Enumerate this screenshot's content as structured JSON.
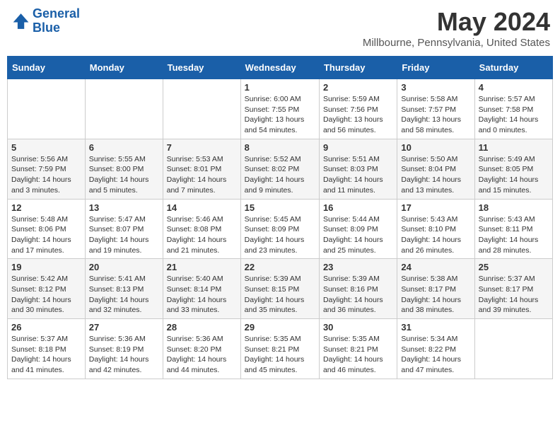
{
  "header": {
    "logo_line1": "General",
    "logo_line2": "Blue",
    "month": "May 2024",
    "location": "Millbourne, Pennsylvania, United States"
  },
  "weekdays": [
    "Sunday",
    "Monday",
    "Tuesday",
    "Wednesday",
    "Thursday",
    "Friday",
    "Saturday"
  ],
  "weeks": [
    [
      {
        "day": "",
        "info": ""
      },
      {
        "day": "",
        "info": ""
      },
      {
        "day": "",
        "info": ""
      },
      {
        "day": "1",
        "info": "Sunrise: 6:00 AM\nSunset: 7:55 PM\nDaylight: 13 hours\nand 54 minutes."
      },
      {
        "day": "2",
        "info": "Sunrise: 5:59 AM\nSunset: 7:56 PM\nDaylight: 13 hours\nand 56 minutes."
      },
      {
        "day": "3",
        "info": "Sunrise: 5:58 AM\nSunset: 7:57 PM\nDaylight: 13 hours\nand 58 minutes."
      },
      {
        "day": "4",
        "info": "Sunrise: 5:57 AM\nSunset: 7:58 PM\nDaylight: 14 hours\nand 0 minutes."
      }
    ],
    [
      {
        "day": "5",
        "info": "Sunrise: 5:56 AM\nSunset: 7:59 PM\nDaylight: 14 hours\nand 3 minutes."
      },
      {
        "day": "6",
        "info": "Sunrise: 5:55 AM\nSunset: 8:00 PM\nDaylight: 14 hours\nand 5 minutes."
      },
      {
        "day": "7",
        "info": "Sunrise: 5:53 AM\nSunset: 8:01 PM\nDaylight: 14 hours\nand 7 minutes."
      },
      {
        "day": "8",
        "info": "Sunrise: 5:52 AM\nSunset: 8:02 PM\nDaylight: 14 hours\nand 9 minutes."
      },
      {
        "day": "9",
        "info": "Sunrise: 5:51 AM\nSunset: 8:03 PM\nDaylight: 14 hours\nand 11 minutes."
      },
      {
        "day": "10",
        "info": "Sunrise: 5:50 AM\nSunset: 8:04 PM\nDaylight: 14 hours\nand 13 minutes."
      },
      {
        "day": "11",
        "info": "Sunrise: 5:49 AM\nSunset: 8:05 PM\nDaylight: 14 hours\nand 15 minutes."
      }
    ],
    [
      {
        "day": "12",
        "info": "Sunrise: 5:48 AM\nSunset: 8:06 PM\nDaylight: 14 hours\nand 17 minutes."
      },
      {
        "day": "13",
        "info": "Sunrise: 5:47 AM\nSunset: 8:07 PM\nDaylight: 14 hours\nand 19 minutes."
      },
      {
        "day": "14",
        "info": "Sunrise: 5:46 AM\nSunset: 8:08 PM\nDaylight: 14 hours\nand 21 minutes."
      },
      {
        "day": "15",
        "info": "Sunrise: 5:45 AM\nSunset: 8:09 PM\nDaylight: 14 hours\nand 23 minutes."
      },
      {
        "day": "16",
        "info": "Sunrise: 5:44 AM\nSunset: 8:09 PM\nDaylight: 14 hours\nand 25 minutes."
      },
      {
        "day": "17",
        "info": "Sunrise: 5:43 AM\nSunset: 8:10 PM\nDaylight: 14 hours\nand 26 minutes."
      },
      {
        "day": "18",
        "info": "Sunrise: 5:43 AM\nSunset: 8:11 PM\nDaylight: 14 hours\nand 28 minutes."
      }
    ],
    [
      {
        "day": "19",
        "info": "Sunrise: 5:42 AM\nSunset: 8:12 PM\nDaylight: 14 hours\nand 30 minutes."
      },
      {
        "day": "20",
        "info": "Sunrise: 5:41 AM\nSunset: 8:13 PM\nDaylight: 14 hours\nand 32 minutes."
      },
      {
        "day": "21",
        "info": "Sunrise: 5:40 AM\nSunset: 8:14 PM\nDaylight: 14 hours\nand 33 minutes."
      },
      {
        "day": "22",
        "info": "Sunrise: 5:39 AM\nSunset: 8:15 PM\nDaylight: 14 hours\nand 35 minutes."
      },
      {
        "day": "23",
        "info": "Sunrise: 5:39 AM\nSunset: 8:16 PM\nDaylight: 14 hours\nand 36 minutes."
      },
      {
        "day": "24",
        "info": "Sunrise: 5:38 AM\nSunset: 8:17 PM\nDaylight: 14 hours\nand 38 minutes."
      },
      {
        "day": "25",
        "info": "Sunrise: 5:37 AM\nSunset: 8:17 PM\nDaylight: 14 hours\nand 39 minutes."
      }
    ],
    [
      {
        "day": "26",
        "info": "Sunrise: 5:37 AM\nSunset: 8:18 PM\nDaylight: 14 hours\nand 41 minutes."
      },
      {
        "day": "27",
        "info": "Sunrise: 5:36 AM\nSunset: 8:19 PM\nDaylight: 14 hours\nand 42 minutes."
      },
      {
        "day": "28",
        "info": "Sunrise: 5:36 AM\nSunset: 8:20 PM\nDaylight: 14 hours\nand 44 minutes."
      },
      {
        "day": "29",
        "info": "Sunrise: 5:35 AM\nSunset: 8:21 PM\nDaylight: 14 hours\nand 45 minutes."
      },
      {
        "day": "30",
        "info": "Sunrise: 5:35 AM\nSunset: 8:21 PM\nDaylight: 14 hours\nand 46 minutes."
      },
      {
        "day": "31",
        "info": "Sunrise: 5:34 AM\nSunset: 8:22 PM\nDaylight: 14 hours\nand 47 minutes."
      },
      {
        "day": "",
        "info": ""
      }
    ]
  ]
}
